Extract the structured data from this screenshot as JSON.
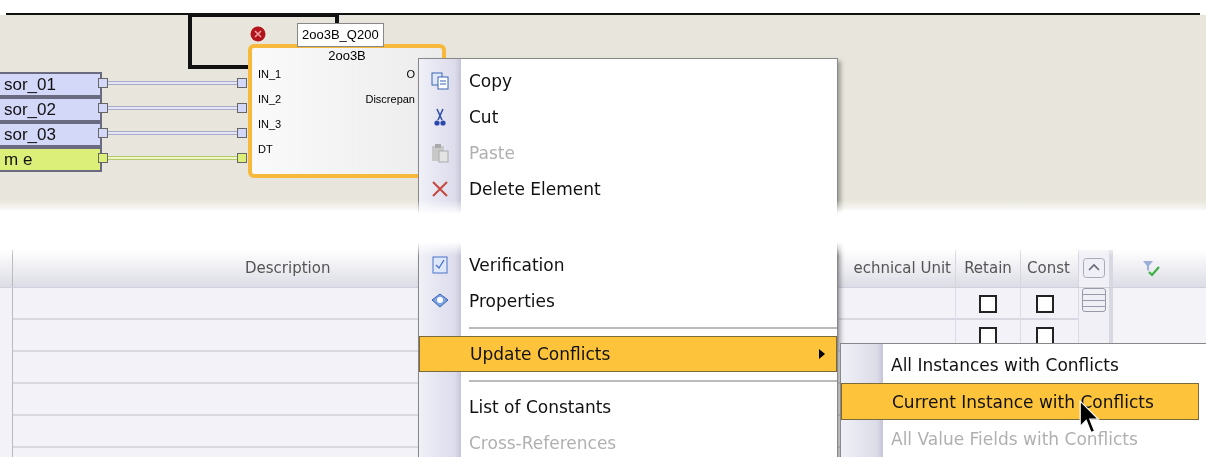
{
  "diagram": {
    "variables": [
      {
        "label": "sor_01",
        "kind": "sensor"
      },
      {
        "label": "sor_02",
        "kind": "sensor"
      },
      {
        "label": "sor_03",
        "kind": "sensor"
      },
      {
        "label": "m e",
        "kind": "time"
      }
    ],
    "block": {
      "instance": "2oo3B_Q200",
      "type": "2oo3B",
      "error": true,
      "selected": true,
      "inputs": [
        "IN_1",
        "IN_2",
        "IN_3",
        "DT"
      ],
      "outputs": [
        "O",
        "Discrepan"
      ]
    }
  },
  "table": {
    "columns": [
      "Description",
      "echnical Unit",
      "Retain",
      "Const"
    ],
    "rows": [
      {
        "retain": false,
        "const": false
      },
      {
        "retain": false,
        "const": false
      }
    ]
  },
  "context_menu": {
    "items": [
      {
        "kind": "item",
        "label": "Copy",
        "disabled": false,
        "selected": false
      },
      {
        "kind": "item",
        "label": "Cut",
        "disabled": false,
        "selected": false
      },
      {
        "kind": "item",
        "label": "Paste",
        "disabled": true,
        "selected": false
      },
      {
        "kind": "item",
        "label": "Delete Element",
        "disabled": false,
        "selected": false
      },
      {
        "kind": "gap"
      },
      {
        "kind": "item",
        "label": "Verification",
        "disabled": false,
        "selected": false
      },
      {
        "kind": "item",
        "label": "Properties",
        "disabled": false,
        "selected": false
      },
      {
        "kind": "separator"
      },
      {
        "kind": "submenu",
        "label": "Update Conflicts",
        "disabled": false,
        "selected": true
      },
      {
        "kind": "separator"
      },
      {
        "kind": "item",
        "label": "List of Constants",
        "disabled": false,
        "selected": false
      },
      {
        "kind": "item",
        "label": "Cross-References",
        "disabled": true,
        "selected": false
      }
    ]
  },
  "submenu": {
    "items": [
      {
        "label": "All Instances with Conflicts",
        "disabled": false,
        "selected": false
      },
      {
        "label": "Current Instance with Conflicts",
        "disabled": false,
        "selected": true
      },
      {
        "label": "All Value Fields with Conflicts",
        "disabled": true,
        "selected": false
      }
    ]
  }
}
